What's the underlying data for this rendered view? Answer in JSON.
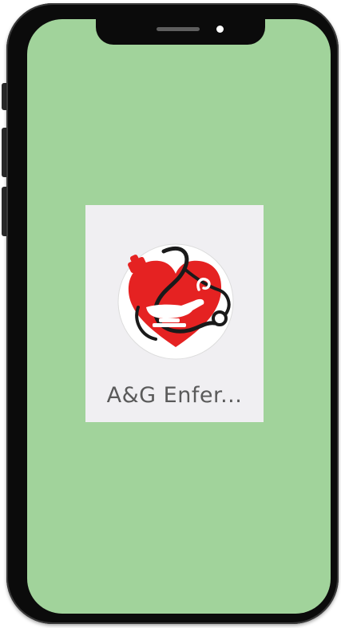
{
  "home_screen": {
    "background_color": "#a1d39b",
    "apps": [
      {
        "label": "A&G Enfer...",
        "icon": "nursing-heart-lamp-icon",
        "icon_colors": {
          "heart": "#e52222",
          "circle": "#ffffff",
          "stethoscope": "#1a1a1a"
        }
      }
    ]
  },
  "device": {
    "frame_color": "#0b0b0b"
  }
}
